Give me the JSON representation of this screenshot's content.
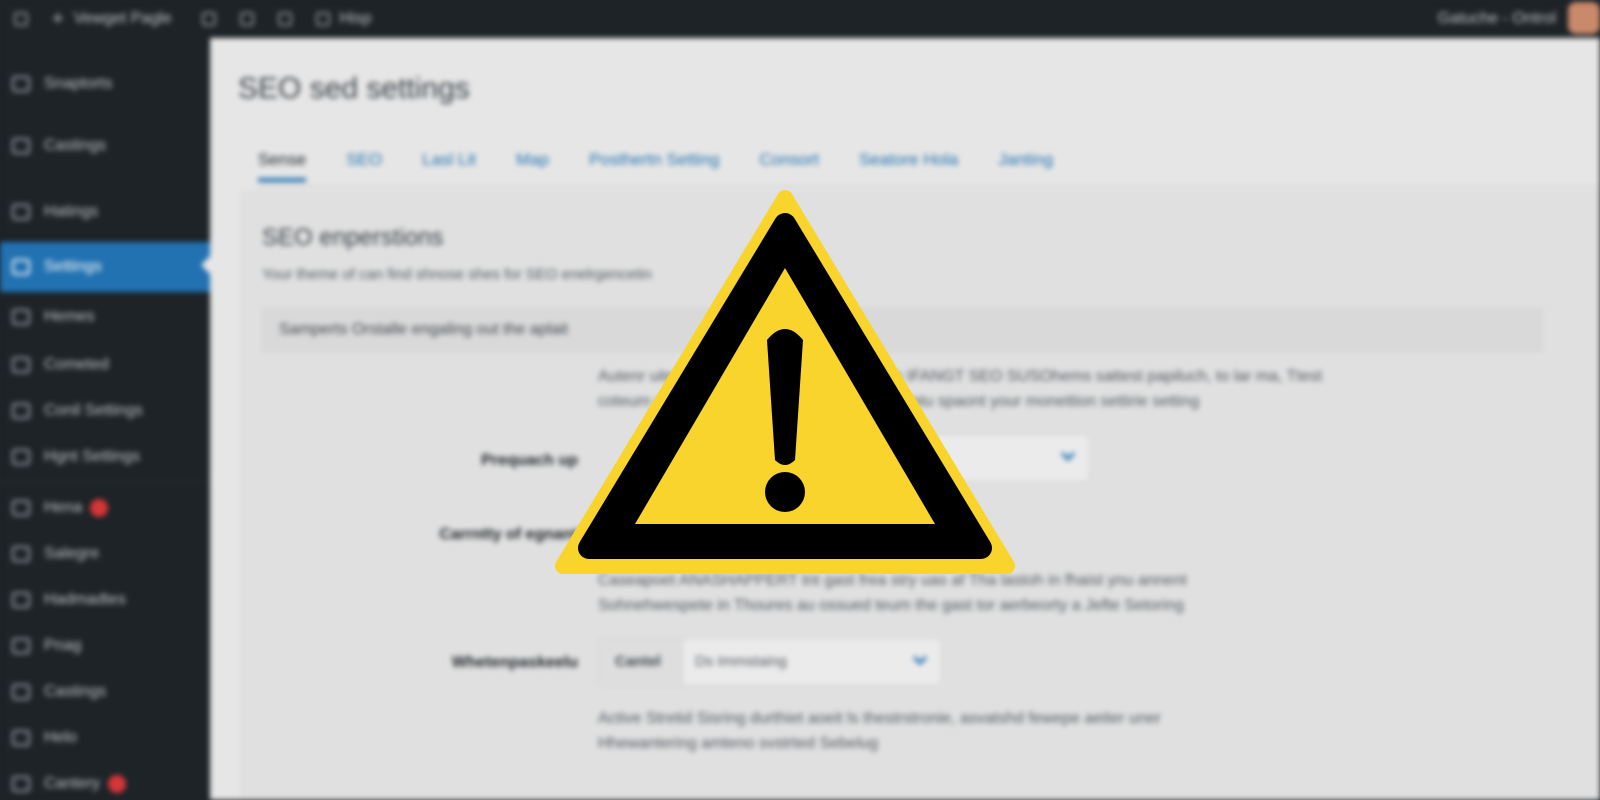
{
  "topbar": {
    "site_name": "Vewget Pagle",
    "menu_item": "Hisp",
    "account": "Gatuche - Ontrol"
  },
  "sidebar": {
    "items": [
      {
        "label": "Snaptorts",
        "icon": "home-icon"
      },
      {
        "label": "Castings",
        "icon": "brush-icon"
      },
      {
        "label": "Hatings",
        "icon": "grid-icon"
      },
      {
        "label": "Settings",
        "icon": "settings-icon",
        "active": true
      },
      {
        "label": "Hemes",
        "icon": "list-icon"
      },
      {
        "label": "Cometed",
        "icon": "page-icon"
      },
      {
        "label": "Conil Settings",
        "icon": "triangle-icon"
      },
      {
        "label": "Hgnt Settings",
        "icon": "table-icon"
      },
      {
        "label": "Hena",
        "icon": "page-icon",
        "badge": true
      },
      {
        "label": "Salegre",
        "icon": "panel-icon"
      },
      {
        "label": "Hadmadtes",
        "icon": "folder-icon"
      },
      {
        "label": "Pnag",
        "icon": "plugin-icon"
      },
      {
        "label": "Castings",
        "icon": "tool-icon"
      },
      {
        "label": "Helo",
        "icon": "help-icon"
      },
      {
        "label": "Cantery",
        "icon": "page-icon",
        "badge": true
      }
    ]
  },
  "main": {
    "page_title": "SEO sed settings",
    "tabs": [
      "Sense",
      "SEO",
      "Lasl Lit",
      "Map",
      "Posthertn Setting",
      "Consort",
      "Seatore Hola",
      "Janting"
    ],
    "section_title": "SEO enperstions",
    "section_desc": "Your theme of can find shnose shes for SEO enelrgencetin",
    "notice": "Samperts  Orstalle engaling out the aplait",
    "para1": [
      "Autenr uite detailit in pul 1de the dae theue IFANGT SEO SUSOhems sattest papiluch, to lar ma, Ttest",
      "coteum osterssulltee fan sedtin a rule the gl ntu spaont your monettion settirie setting"
    ],
    "row1_label": "Prequach up",
    "row2_label": "Carrntty of egnant",
    "para2": [
      "Caseapoet ANASHAPPERT tnt gast frea stry uas af Tha lastoh in fhaist ynu annent",
      "Sohnehwespete in Thoures au ossued teum the gast tor aerbeorty a Jefte Setoring"
    ],
    "row3_label": "Whetenpaskeelu",
    "select3_prefix": "Cantel",
    "select3_value": "Ds Immstaing",
    "para3": [
      "Active Stretid Sisring durthiet aoeit ls thestrstronie, asvatshd fewepe aeiter uner",
      "Hhewantering amteno svstrted Sebelug"
    ]
  },
  "overlay": {
    "icon": "warning-triangle-icon",
    "fill": "#f8d42c",
    "stroke": "#000000"
  }
}
